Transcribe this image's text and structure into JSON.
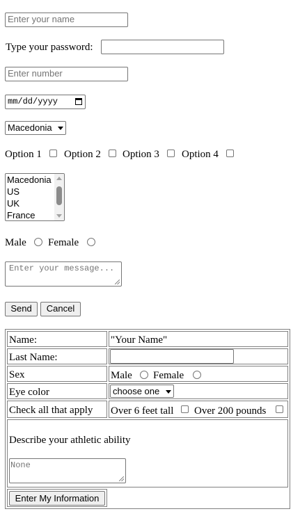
{
  "form": {
    "name_placeholder": "Enter your name",
    "password_label": "Type your password:",
    "number_placeholder": "Enter number",
    "date_placeholder": "mm/dd/yyyy",
    "country_selected": "Macedonia",
    "options": [
      "Option 1",
      "Option 2",
      "Option 3",
      "Option 4"
    ],
    "country_list": [
      "Macedonia",
      "US",
      "UK",
      "France"
    ],
    "gender_male": "Male",
    "gender_female": "Female",
    "message_placeholder": "Enter your message...",
    "send_label": "Send",
    "cancel_label": "Cancel"
  },
  "table": {
    "name_label": "Name:",
    "name_value": "\"Your Name\"",
    "last_name_label": "Last Name:",
    "sex_label": "Sex",
    "sex_male": "Male",
    "sex_female": "Female",
    "eye_color_label": "Eye color",
    "eye_color_selected": "choose one",
    "check_label": "Check all that apply",
    "check_tall": "Over 6 feet tall",
    "check_heavy": "Over 200 pounds",
    "athletic_label": "Describe your athletic ability",
    "athletic_placeholder": "None",
    "submit_label": "Enter My Information"
  }
}
